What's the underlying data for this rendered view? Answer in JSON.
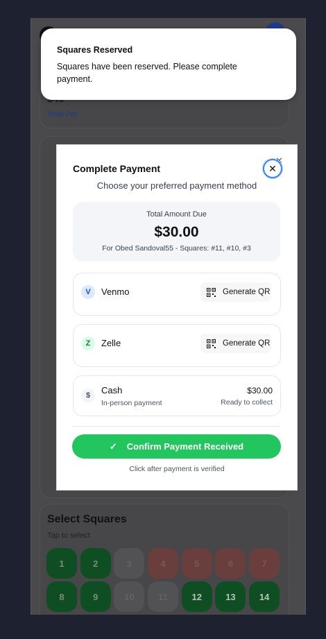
{
  "background_app": {
    "pot_value": "$40",
    "pot_label": "Total Pot",
    "select_title": "Select Squares",
    "select_subtitle": "Tap to select",
    "squares": [
      {
        "n": "1",
        "state": "available"
      },
      {
        "n": "2",
        "state": "available"
      },
      {
        "n": "3",
        "state": "reserved"
      },
      {
        "n": "4",
        "state": "taken"
      },
      {
        "n": "5",
        "state": "taken"
      },
      {
        "n": "6",
        "state": "taken"
      },
      {
        "n": "7",
        "state": "taken"
      },
      {
        "n": "8",
        "state": "available"
      },
      {
        "n": "9",
        "state": "available"
      },
      {
        "n": "10",
        "state": "reserved"
      },
      {
        "n": "11",
        "state": "reserved"
      },
      {
        "n": "12",
        "state": "selected"
      },
      {
        "n": "13",
        "state": "selected"
      },
      {
        "n": "14",
        "state": "selected"
      }
    ]
  },
  "toast": {
    "title": "Squares Reserved",
    "message": "Squares have been reserved. Please complete payment."
  },
  "modal": {
    "title": "Complete Payment",
    "close_glyph": "✕",
    "subtitle": "Choose your preferred payment method",
    "due_label": "Total Amount Due",
    "due_amount": "$30.00",
    "due_for": "For Obed Sandoval55 - Squares: #11, #10, #3",
    "methods": [
      {
        "letter": "V",
        "name": "Venmo",
        "action": "Generate QR",
        "icon_bg": "#dbeafe",
        "icon_color": "#1d4ed8"
      },
      {
        "letter": "Z",
        "name": "Zelle",
        "action": "Generate QR",
        "icon_bg": "#dcfce7",
        "icon_color": "#15803d"
      }
    ],
    "cash": {
      "letter": "$",
      "name": "Cash",
      "sub": "In-person payment",
      "amount": "$30.00",
      "status": "Ready to collect"
    },
    "confirm_label": "Confirm Payment Received",
    "confirm_note": "Click after payment is verified"
  },
  "colors": {
    "accent_green": "#22c55e",
    "focus_blue": "#3b82f6",
    "page_bg": "#1e2230"
  }
}
